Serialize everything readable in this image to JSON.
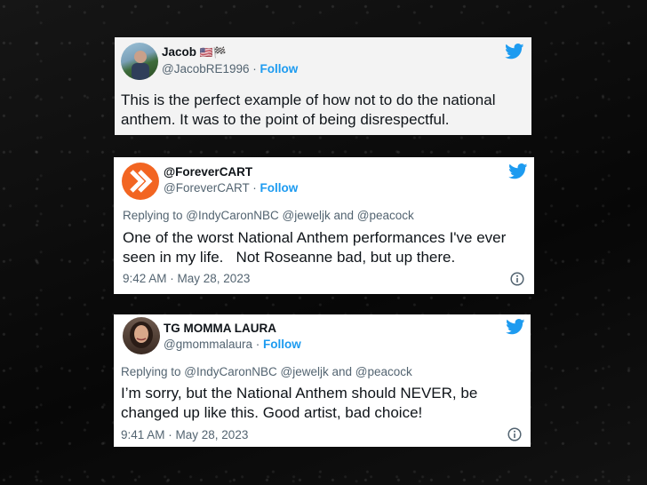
{
  "tweets": [
    {
      "name": "Jacob",
      "name_emoji": "🇺🇸🏁",
      "handle": "@JacobRE1996",
      "separator": "·",
      "follow": "Follow",
      "body": "This is the perfect example of how not to do the national anthem. It was to the point of being disrespectful."
    },
    {
      "name": "@ForeverCART",
      "handle": "@ForeverCART",
      "separator": "·",
      "follow": "Follow",
      "replying": "Replying to @IndyCaronNBC @jeweljk and @peacock",
      "body_line1": "One of the worst National Anthem performances I've ever",
      "body_line2": "seen in my life.   Not Roseanne bad, but up there.",
      "time": "9:42 AM · May 28, 2023"
    },
    {
      "name": "TG MOMMA LAURA",
      "handle": "@gmommalaura",
      "separator": "·",
      "follow": "Follow",
      "replying": "Replying to @IndyCaronNBC @jeweljk and @peacock",
      "body_line1": "I’m sorry, but the National Anthem should NEVER, be",
      "body_line2": "changed up like this. Good artist, bad choice!",
      "time": "9:41 AM · May 28, 2023"
    }
  ],
  "colors": {
    "twitter_blue": "#1d9bf0",
    "forevercart_orange": "#f26522"
  },
  "icons": [
    "twitter-bird-icon",
    "info-icon"
  ]
}
